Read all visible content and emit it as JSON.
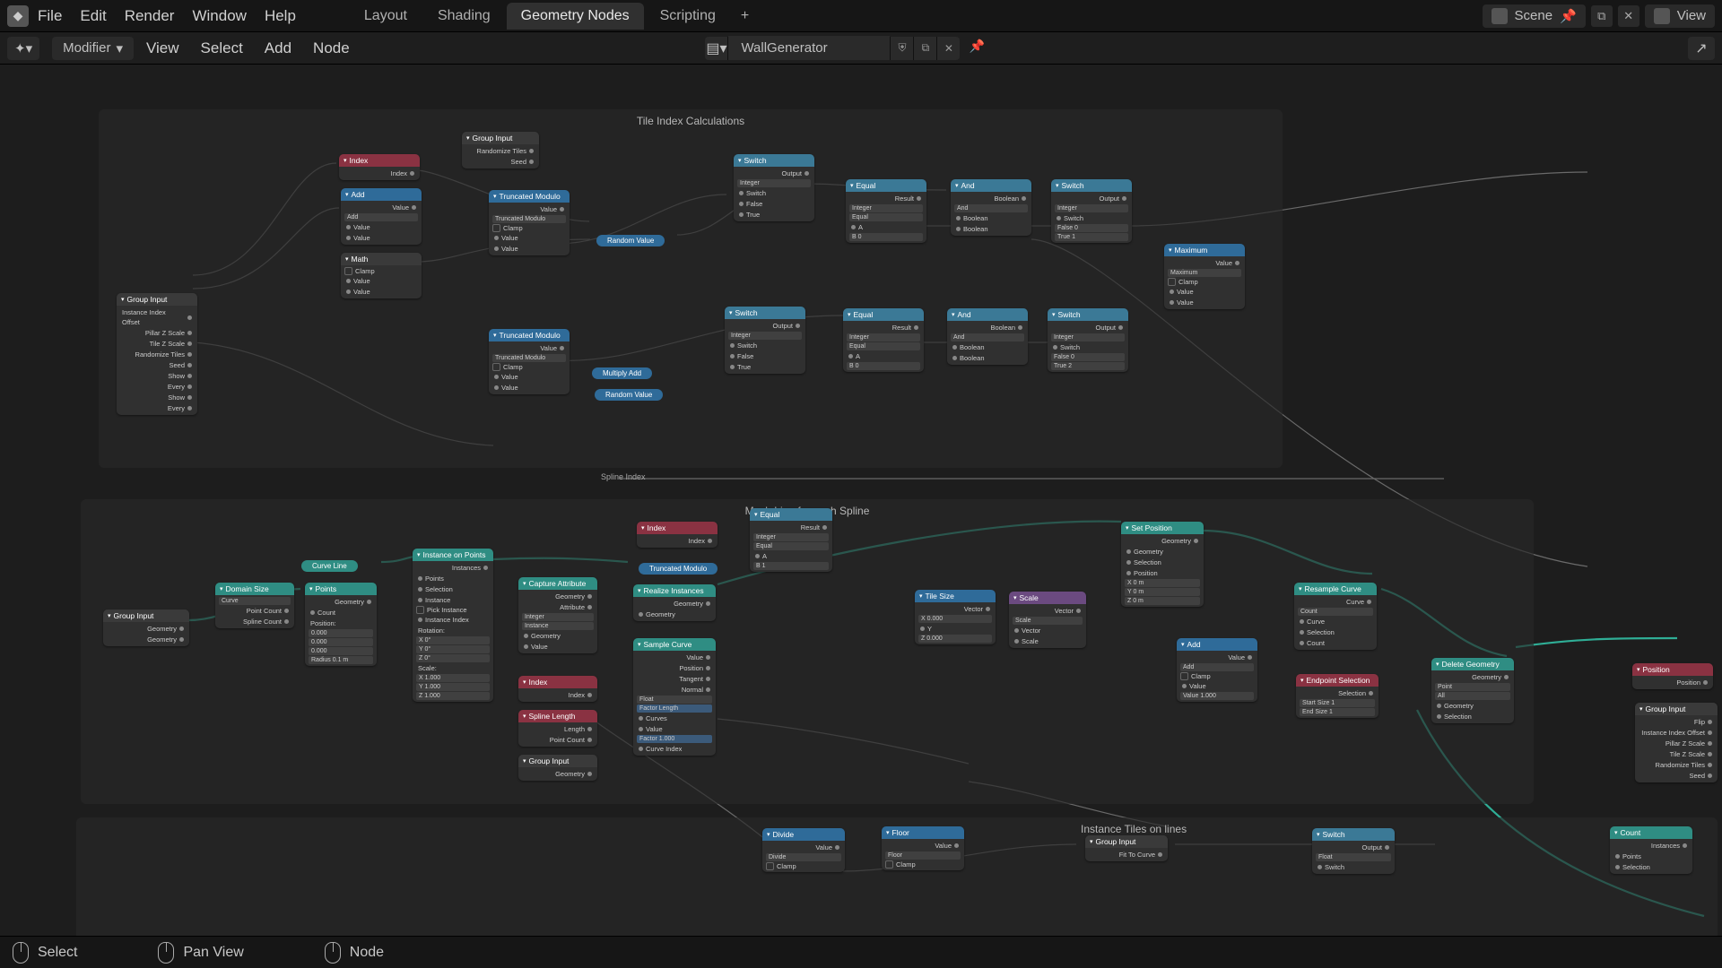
{
  "menubar": {
    "file": "File",
    "edit": "Edit",
    "render": "Render",
    "window": "Window",
    "help": "Help"
  },
  "workspaces": {
    "layout": "Layout",
    "shading": "Shading",
    "geonodes": "Geometry Nodes",
    "scripting": "Scripting"
  },
  "scene_label": "Scene",
  "view_label": "View",
  "modifier_label": "Modifier",
  "menu2": {
    "view": "View",
    "select": "Select",
    "add": "Add",
    "node": "Node"
  },
  "nodegroup_name": "WallGenerator",
  "status": {
    "select": "Select",
    "pan": "Pan View",
    "node": "Node"
  },
  "frames": {
    "a": "Tile Index Calculations",
    "b": "Spline Index",
    "c": "Mesh Line for each Spline",
    "d": "Instance Tiles on lines"
  },
  "nodes": {
    "group_input1": {
      "t": "Group Input",
      "f": [
        "Instance Index Offset",
        "Pillar Z Scale",
        "Tile Z Scale",
        "Randomize Tiles",
        "Seed",
        "Show",
        "Every",
        "Show",
        "Every"
      ]
    },
    "index1": {
      "t": "Index",
      "o": "Index"
    },
    "add1": {
      "t": "Add",
      "o": "Value",
      "f": [
        "Add",
        "Value",
        "Value"
      ]
    },
    "math_clamp": {
      "t": "Math",
      "f": [
        "Clamp",
        "Value",
        "Value"
      ]
    },
    "group_input2": {
      "t": "Group Input",
      "f": [
        "Randomize Tiles",
        "Seed"
      ]
    },
    "trmod1": {
      "t": "Truncated Modulo",
      "o": "Value",
      "f": [
        "Truncated Modulo",
        "Clamp",
        "Value",
        "Value"
      ]
    },
    "trmod2": {
      "t": "Truncated Modulo",
      "o": "Value",
      "f": [
        "Truncated Modulo",
        "Clamp",
        "Value",
        "Value"
      ]
    },
    "randval1": {
      "t": "Random Value"
    },
    "muladd": {
      "t": "Multiply Add"
    },
    "randval2": {
      "t": "Random Value"
    },
    "switch1": {
      "t": "Switch",
      "o": "Output",
      "f": [
        "Integer",
        "Switch",
        "False",
        "True"
      ]
    },
    "switch2": {
      "t": "Switch",
      "o": "Output",
      "f": [
        "Integer",
        "Switch",
        "False",
        "True"
      ]
    },
    "equal1": {
      "t": "Equal",
      "o": "Result",
      "f": [
        "Integer",
        "Equal",
        "A",
        "B                          0"
      ]
    },
    "equal2": {
      "t": "Equal",
      "o": "Result",
      "f": [
        "Integer",
        "Equal",
        "A",
        "B                          0"
      ]
    },
    "and1": {
      "t": "And",
      "o": "Boolean",
      "f": [
        "And",
        "Boolean",
        "Boolean"
      ]
    },
    "and2": {
      "t": "And",
      "o": "Boolean",
      "f": [
        "And",
        "Boolean",
        "Boolean"
      ]
    },
    "swint1": {
      "t": "Switch",
      "o": "Output",
      "f": [
        "Integer",
        "Switch",
        "False             0",
        "True               1"
      ]
    },
    "swint2": {
      "t": "Switch",
      "o": "Output",
      "f": [
        "Integer",
        "Switch",
        "False             0",
        "True               2"
      ]
    },
    "max": {
      "t": "Maximum",
      "o": "Value",
      "f": [
        "Maximum",
        "Clamp",
        "Value",
        "Value"
      ]
    },
    "group_input3": {
      "t": "Group Input",
      "o": "Geometry",
      "f": [
        "Geometry"
      ]
    },
    "domsize": {
      "t": "Domain Size",
      "f": [
        "Curve",
        "Point Count",
        "Spline Count"
      ]
    },
    "curveline": {
      "t": "Curve Line"
    },
    "points": {
      "t": "Points",
      "o": "Geometry",
      "f": [
        "Count",
        "Position:",
        "0.000",
        "0.000",
        "0.000",
        "Radius       0.1 m"
      ]
    },
    "iop": {
      "t": "Instance on Points",
      "o": "Instances",
      "f": [
        "Points",
        "Selection",
        "Instance",
        "Pick Instance",
        "Instance Index",
        "Rotation:",
        "X               0°",
        "Y               0°",
        "Z               0°",
        "Scale:",
        "X          1.000",
        "Y          1.000",
        "Z          1.000"
      ]
    },
    "capattr": {
      "t": "Capture Attribute",
      "o": "Geometry",
      "oa": "Attribute",
      "f": [
        "Integer",
        "Instance",
        "Geometry",
        "Value"
      ]
    },
    "index2": {
      "t": "Index",
      "o": "Index"
    },
    "spllen": {
      "t": "Spline Length",
      "f": [
        "Length",
        "Point Count"
      ]
    },
    "group_input4": {
      "t": "Group Input",
      "o": "Geometry"
    },
    "index3": {
      "t": "Index",
      "o": "Index"
    },
    "trmod3": {
      "t": "Truncated Modulo"
    },
    "realize": {
      "t": "Realize Instances",
      "o": "Geometry",
      "f": [
        "Geometry"
      ]
    },
    "sampcurve": {
      "t": "Sample Curve",
      "f": [
        "Value",
        "Position",
        "Tangent",
        "Normal",
        "Float",
        "Factor   Length",
        "Curves",
        "Value",
        "Factor        1.000",
        "Curve Index"
      ],
      "o": "Value"
    },
    "equal3": {
      "t": "Equal",
      "o": "Result",
      "f": [
        "Integer",
        "Equal",
        "A",
        "B                          1"
      ]
    },
    "tilesize": {
      "t": "Tile Size",
      "o": "Vector",
      "f": [
        "X            0.000",
        "Y",
        "Z            0.000"
      ]
    },
    "scale": {
      "t": "Scale",
      "o": "Vector",
      "f": [
        "Scale",
        "Vector",
        "Scale"
      ]
    },
    "setpos": {
      "t": "Set Position",
      "o": "Geometry",
      "f": [
        "Geometry",
        "Selection",
        "Position",
        "X                 0 m",
        "Y                 0 m",
        "Z                 0 m"
      ]
    },
    "add2": {
      "t": "Add",
      "o": "Value",
      "f": [
        "Add",
        "Clamp",
        "Value",
        "Value        1.000"
      ]
    },
    "resample": {
      "t": "Resample Curve",
      "o": "Curve",
      "f": [
        "Count",
        "Curve",
        "Selection",
        "Count"
      ]
    },
    "endsel": {
      "t": "Endpoint Selection",
      "o": "Selection",
      "f": [
        "Start Size       1",
        "End Size         1"
      ]
    },
    "delgeo": {
      "t": "Delete Geometry",
      "o": "Geometry",
      "f": [
        "Point",
        "All",
        "Geometry",
        "Selection"
      ]
    },
    "position": {
      "t": "Position",
      "o": "Position"
    },
    "group_input5": {
      "t": "Group Input",
      "f": [
        "Flip",
        "Instance Index Offset",
        "Pillar Z Scale",
        "Tile Z Scale",
        "Randomize Tiles",
        "Seed"
      ]
    },
    "count": {
      "t": "Count",
      "o": "Instances",
      "f": [
        "Points",
        "Selection"
      ]
    },
    "divide": {
      "t": "Divide",
      "o": "Value",
      "f": [
        "Divide",
        "Clamp"
      ]
    },
    "floor": {
      "t": "Floor",
      "o": "Value",
      "f": [
        "Floor",
        "Clamp"
      ]
    },
    "group_input6": {
      "t": "Group Input",
      "f": [
        "Fit To Curve"
      ]
    },
    "switch3": {
      "t": "Switch",
      "o": "Output",
      "f": [
        "Float",
        "Switch"
      ]
    }
  }
}
